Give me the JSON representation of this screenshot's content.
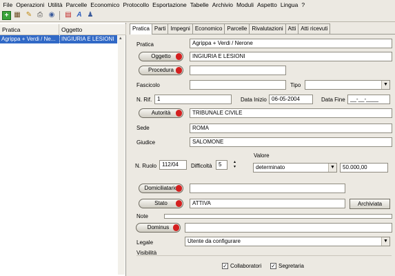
{
  "menu": [
    "File",
    "Operazioni",
    "Utilità",
    "Parcelle",
    "Economico",
    "Protocollo",
    "Esportazione",
    "Tabelle",
    "Archivio",
    "Moduli",
    "Aspetto",
    "Lingua",
    "?"
  ],
  "toolbar": {
    "icons": [
      "new-icon",
      "grid-icon",
      "key-icon",
      "print-icon",
      "view-icon",
      "calendar-icon",
      "text-icon",
      "user-icon"
    ],
    "glyphs": {
      "new": "+",
      "grid": "▦",
      "key": "✎",
      "print": "⎙",
      "view": "◉",
      "calendar": "▤",
      "text": "A",
      "user": "♟"
    }
  },
  "list": {
    "headers": [
      "Pratica",
      "Oggetto"
    ],
    "rows": [
      {
        "pratica": "Agrippa + Verdi / Ne...",
        "oggetto": "INGIURIA E LESIONI"
      }
    ],
    "scroll_up": "▴"
  },
  "tabs": [
    "Pratica",
    "Parti",
    "Impegni",
    "Economico",
    "Parcelle",
    "Rivalutazioni",
    "Atti",
    "Atti ricevuti"
  ],
  "form": {
    "pratica_label": "Pratica",
    "pratica_value": "Agrippa + Verdi / Nerone",
    "oggetto_btn": "Oggetto",
    "oggetto_value": "INGIURIA E LESIONI",
    "procedura_btn": "Procedura",
    "procedura_value": "",
    "fascicolo_label": "Fascicolo",
    "fascicolo_value": "",
    "tipo_label": "Tipo",
    "tipo_value": "",
    "nrif_label": "N. Rif.",
    "nrif_value": "1",
    "data_inizio_label": "Data Inizio",
    "data_inizio_value": "06-05-2004",
    "data_fine_label": "Data Fine",
    "data_fine_value": "__-__-____",
    "autorita_btn": "Autorità",
    "autorita_value": "TRIBUNALE CIVILE",
    "sede_label": "Sede",
    "sede_value": "ROMA",
    "giudice_label": "Giudice",
    "giudice_value": "SALOMONE",
    "valore_label": "Valore",
    "nruolo_label": "N. Ruolo",
    "nruolo_value": "112/04",
    "difficolta_label": "Difficoltà",
    "difficolta_value": "5",
    "valore_tipo": "determinato",
    "valore_importo": "50.000,00",
    "domiciliatario_btn": "Domiciliatario",
    "domiciliatario_value": "",
    "stato_btn": "Stato",
    "stato_value": "ATTIVA",
    "archiviata_btn": "Archiviata",
    "note_label": "Note",
    "dominus_btn": "Dominus",
    "dominus_value": "",
    "legale_label": "Legale",
    "legale_value": "Utente da configurare",
    "visibilita_label": "Visibilità",
    "collaboratori_label": "Collaboratori",
    "collaboratori_checked": true,
    "check_mark": "✓",
    "segretaria_label": "Segretaria",
    "segretaria_checked": true
  }
}
